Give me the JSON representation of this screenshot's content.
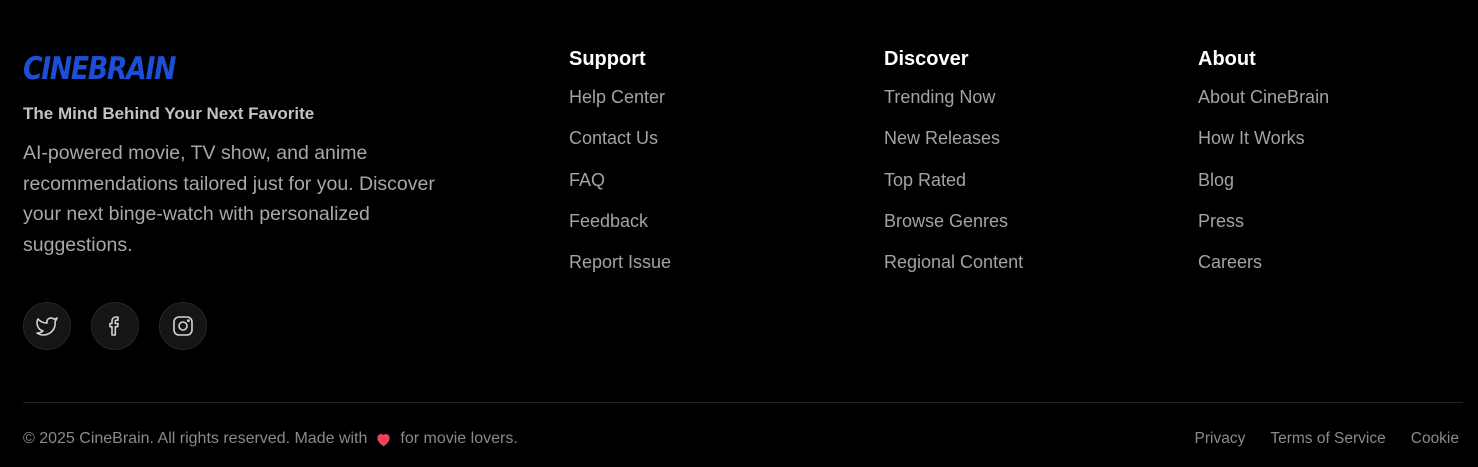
{
  "brand": {
    "logo_text": "CINEBRAIN",
    "tagline": "The Mind Behind Your Next Favorite",
    "description": "AI-powered movie, TV show, and anime recommendations tailored just for you. Discover your next binge-watch with personalized suggestions.",
    "accent_color": "#1d4ed8"
  },
  "socials": [
    {
      "icon": "twitter-icon"
    },
    {
      "icon": "facebook-icon"
    },
    {
      "icon": "instagram-icon"
    }
  ],
  "columns": {
    "support": {
      "title": "Support",
      "links": [
        "Help Center",
        "Contact Us",
        "FAQ",
        "Feedback",
        "Report Issue"
      ]
    },
    "discover": {
      "title": "Discover",
      "links": [
        "Trending Now",
        "New Releases",
        "Top Rated",
        "Browse Genres",
        "Regional Content"
      ]
    },
    "about": {
      "title": "About",
      "links": [
        "About CineBrain",
        "How It Works",
        "Blog",
        "Press",
        "Careers"
      ]
    }
  },
  "bottom": {
    "copyright_before": "© 2025 CineBrain. All rights reserved. Made with",
    "heart_icon": "heart-icon",
    "copyright_after": "for movie lovers.",
    "legal_links": [
      "Privacy",
      "Terms of Service",
      "Cookie"
    ]
  }
}
